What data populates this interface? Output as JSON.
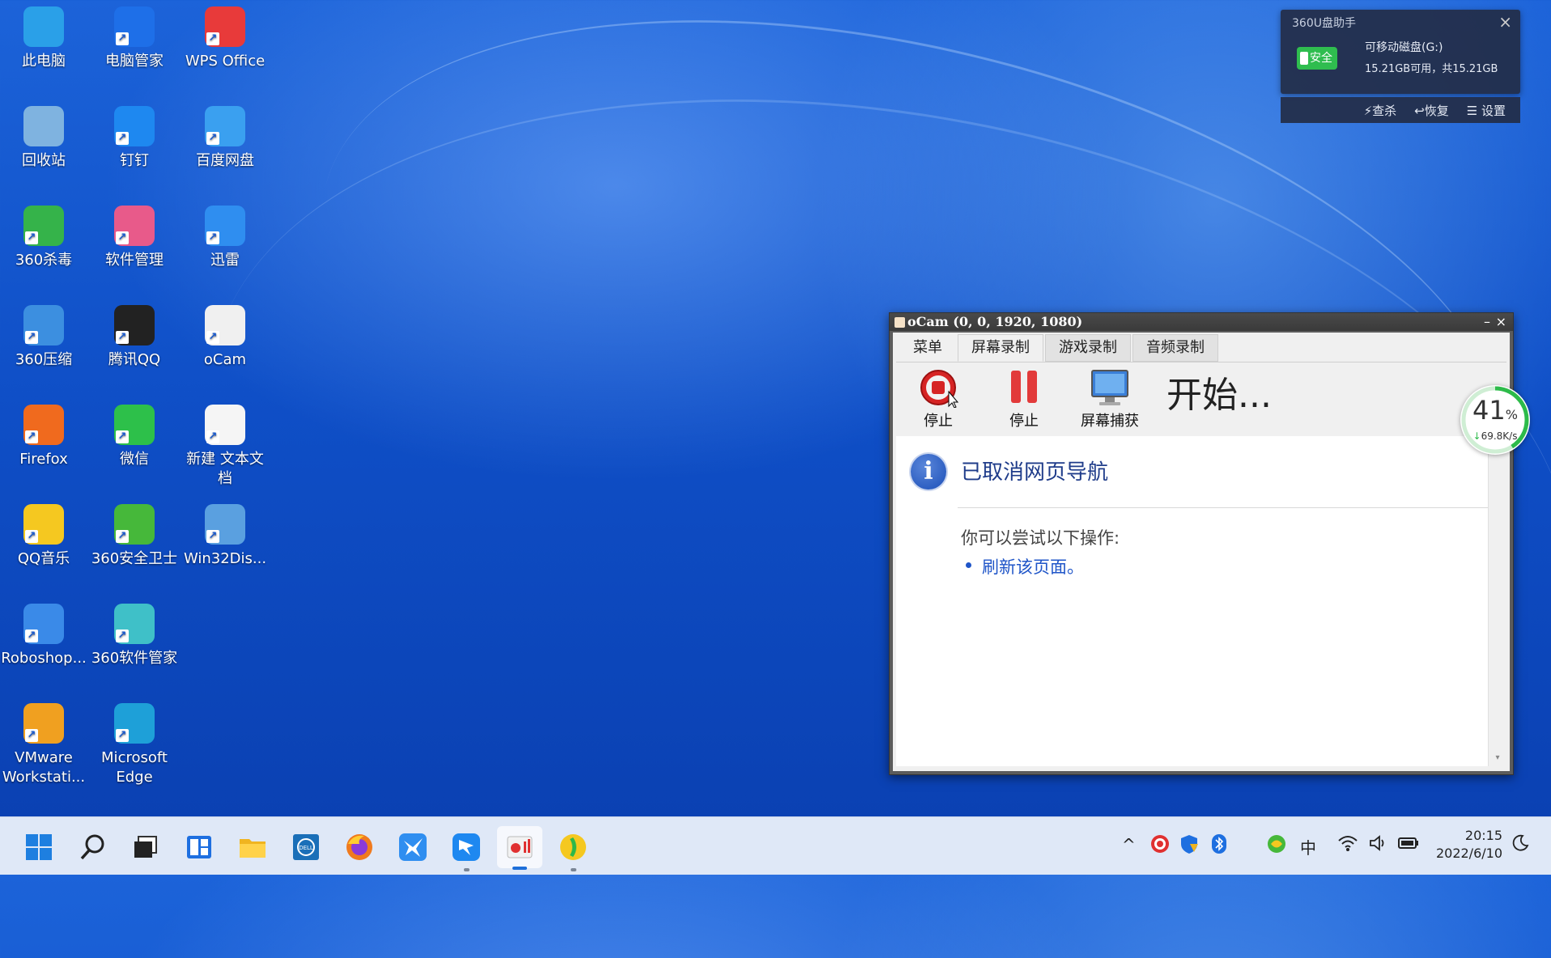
{
  "desktop_icons": [
    {
      "label": "此电脑",
      "icon": "computer-icon",
      "color": "#2aa0e8"
    },
    {
      "label": "电脑管家",
      "icon": "pc-manager-icon",
      "color": "#1e6fe8"
    },
    {
      "label": "WPS Office",
      "icon": "wps-icon",
      "color": "#e83a3a"
    },
    {
      "label": "回收站",
      "icon": "recycle-bin-icon",
      "color": "#7fb3e0"
    },
    {
      "label": "钉钉",
      "icon": "dingtalk-icon",
      "color": "#1e88f0"
    },
    {
      "label": "百度网盘",
      "icon": "baidu-netdisk-icon",
      "color": "#3aa0f0"
    },
    {
      "label": "360杀毒",
      "icon": "360-antivirus-icon",
      "color": "#35b34a"
    },
    {
      "label": "软件管理",
      "icon": "software-manager-icon",
      "color": "#e85a8a"
    },
    {
      "label": "迅雷",
      "icon": "xunlei-icon",
      "color": "#2f8ef0"
    },
    {
      "label": "360压缩",
      "icon": "360-zip-icon",
      "color": "#3c8fe0"
    },
    {
      "label": "腾讯QQ",
      "icon": "qq-icon",
      "color": "#222222"
    },
    {
      "label": "oCam",
      "icon": "ocam-icon",
      "color": "#f0f0f0"
    },
    {
      "label": "Firefox",
      "icon": "firefox-icon",
      "color": "#f06a1e"
    },
    {
      "label": "微信",
      "icon": "wechat-icon",
      "color": "#2dc04a"
    },
    {
      "label": "新建 文本文档",
      "icon": "text-file-icon",
      "color": "#f5f5f5"
    },
    {
      "label": "QQ音乐",
      "icon": "qq-music-icon",
      "color": "#f5c820"
    },
    {
      "label": "360安全卫士",
      "icon": "360-security-icon",
      "color": "#46b83a"
    },
    {
      "label": "Win32Dis...",
      "icon": "win32disk-icon",
      "color": "#5aa0e0"
    },
    {
      "label": "Roboshop...",
      "icon": "roboshop-icon",
      "color": "#3a8ae8"
    },
    {
      "label": "360软件管家",
      "icon": "360-software-icon",
      "color": "#3fc0c8"
    },
    {
      "label": "VMware Workstati...",
      "icon": "vmware-icon",
      "color": "#f0a020"
    },
    {
      "label": "Microsoft Edge",
      "icon": "edge-icon",
      "color": "#1ea0d8"
    }
  ],
  "upanel": {
    "title": "360U盘助手",
    "badge": "安全",
    "drive": "可移动磁盘(G:)",
    "space": "15.21GB可用，共15.21GB",
    "actions": [
      "查杀",
      "恢复",
      "设置"
    ]
  },
  "ocam": {
    "title": "oCam (0, 0, 1920, 1080)",
    "tabs": [
      "菜单",
      "屏幕录制",
      "游戏录制",
      "音频录制"
    ],
    "buttons": [
      "停止",
      "停止",
      "屏幕捕获"
    ],
    "status": "开始...",
    "page": {
      "title": "已取消网页导航",
      "try": "你可以尝试以下操作:",
      "refresh": "刷新该页面。"
    }
  },
  "gauge": {
    "percent": "41",
    "unit": "%",
    "speed": "69.8K/s",
    "fraction": 0.41
  },
  "taskbar": {
    "apps": [
      "start-icon",
      "search-icon",
      "task-view-icon",
      "widgets-icon",
      "file-explorer-icon",
      "dell-icon",
      "firefox-icon",
      "xunlei-icon",
      "dingtalk-icon",
      "ocam-icon",
      "qq-music-icon"
    ],
    "ime": "中",
    "time": "20:15",
    "date": "2022/6/10"
  }
}
